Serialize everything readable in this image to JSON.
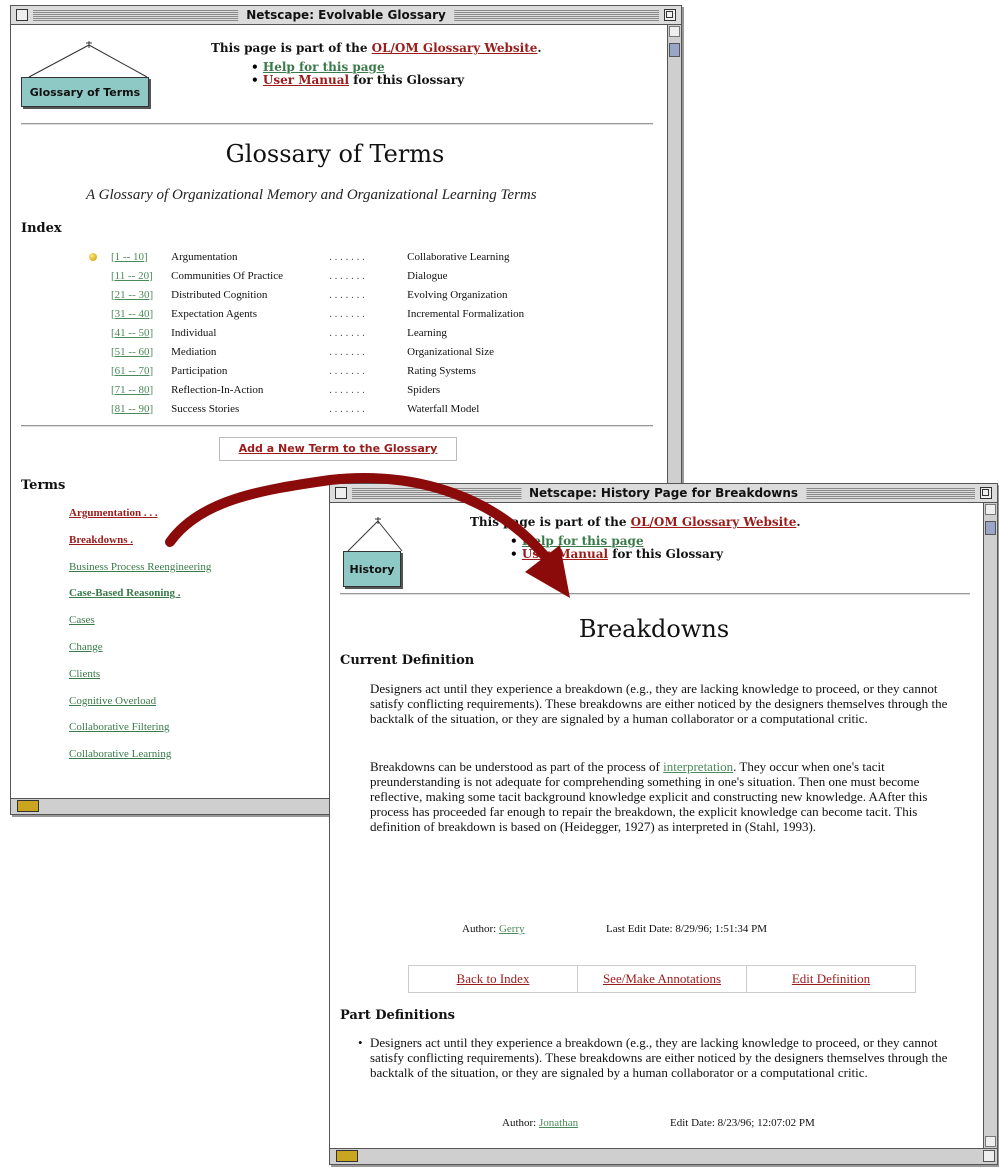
{
  "win1": {
    "title": "Netscape: Evolvable Glossary",
    "sign_label": "Glossary of Terms",
    "header": {
      "part_prefix": "This page is part of the ",
      "part_link": "OL/OM Glossary Website",
      "part_suffix": ".",
      "help_link": "Help for this page",
      "manual_link": "User Manual",
      "manual_suffix": " for this Glossary"
    },
    "heading": "Glossary of Terms",
    "subtitle": "A Glossary of Organizational Memory and Organizational Learning Terms",
    "index_heading": "Index",
    "index_rows": [
      {
        "range": "[1 -- 10]",
        "from": "Argumentation",
        "dots": ". . . . . . .",
        "to": "Collaborative Learning"
      },
      {
        "range": "[11 -- 20]",
        "from": "Communities Of Practice",
        "dots": ". . . . . . .",
        "to": "Dialogue"
      },
      {
        "range": "[21 -- 30]",
        "from": "Distributed Cognition",
        "dots": ". . . . . . .",
        "to": "Evolving Organization"
      },
      {
        "range": "[31 -- 40]",
        "from": "Expectation Agents",
        "dots": ". . . . . . .",
        "to": "Incremental Formalization"
      },
      {
        "range": "[41 -- 50]",
        "from": "Individual",
        "dots": ". . . . . . .",
        "to": "Learning"
      },
      {
        "range": "[51 -- 60]",
        "from": "Mediation",
        "dots": ". . . . . . .",
        "to": "Organizational Size"
      },
      {
        "range": "[61 -- 70]",
        "from": "Participation",
        "dots": ". . . . . . .",
        "to": "Rating Systems"
      },
      {
        "range": "[71 -- 80]",
        "from": "Reflection-In-Action",
        "dots": ". . . . . . .",
        "to": "Spiders"
      },
      {
        "range": "[81 -- 90]",
        "from": "Success Stories",
        "dots": ". . . . . . .",
        "to": "Waterfall Model"
      }
    ],
    "add_button": "Add a New Term to the Glossary",
    "terms_heading": "Terms",
    "terms": [
      {
        "label": "Argumentation . . .",
        "style": "red bold"
      },
      {
        "label": "Breakdowns .",
        "style": "red bold"
      },
      {
        "label": "Business Process Reengineering",
        "style": "green"
      },
      {
        "label": "Case-Based Reasoning .",
        "style": "green bold"
      },
      {
        "label": "Cases",
        "style": "green"
      },
      {
        "label": "Change",
        "style": "green"
      },
      {
        "label": "Clients",
        "style": "green"
      },
      {
        "label": "Cognitive Overload",
        "style": "green"
      },
      {
        "label": "Collaborative Filtering",
        "style": "green"
      },
      {
        "label": "Collaborative Learning",
        "style": "green"
      }
    ]
  },
  "win2": {
    "title": "Netscape: History Page for Breakdowns",
    "sign_label": "History",
    "header": {
      "part_prefix": "This page is part of the ",
      "part_link": "OL/OM Glossary Website",
      "part_suffix": ".",
      "help_link": "Help for this page",
      "manual_link": "User Manual",
      "manual_suffix": " for this Glossary"
    },
    "heading": "Breakdowns",
    "current_heading": "Current Definition",
    "def_p1": "Designers act until they experience a breakdown (e.g., they are lacking knowledge to proceed, or they cannot satisfy conflicting requirements). These breakdowns are either noticed by the designers themselves through the backtalk of the situation, or they are signaled by a human collaborator or a computational critic.",
    "def_p2_before": "Breakdowns can be understood as part of the process of ",
    "def_p2_link": "interpretation",
    "def_p2_after": ". They occur when one's tacit preunderstanding is not adequate for comprehending something in one's situation. Then one must become reflective, making some tacit background knowledge explicit and constructing new knowledge. AAfter this process has proceeded far enough to repair the breakdown, the explicit knowledge can become tacit. This definition of breakdown is based on (Heidegger, 1927) as interpreted in (Stahl, 1993).",
    "author_label": "Author: ",
    "author_name": "Gerry",
    "edit_date": "Last Edit Date: 8/29/96; 1:51:34 PM",
    "actions": [
      "Back to Index",
      "See/Make Annotations",
      "Edit Definition"
    ],
    "part_heading": "Part Definitions",
    "part_def": "Designers act until they experience a breakdown (e.g., they are lacking knowledge to proceed, or they cannot satisfy conflicting requirements). These breakdowns are either noticed by the designers themselves through the backtalk of the situation, or they are signaled by a human collaborator or a computational critic.",
    "part_author_label": "Author: ",
    "part_author_name": "Jonathan",
    "part_edit_date": "Edit Date: 8/23/96; 12:07:02 PM"
  },
  "colors": {
    "link_green": "#4b8a5a",
    "link_red": "#9b1b1b",
    "sign": "#8ec9c5",
    "arrow": "#8b0a0a"
  }
}
